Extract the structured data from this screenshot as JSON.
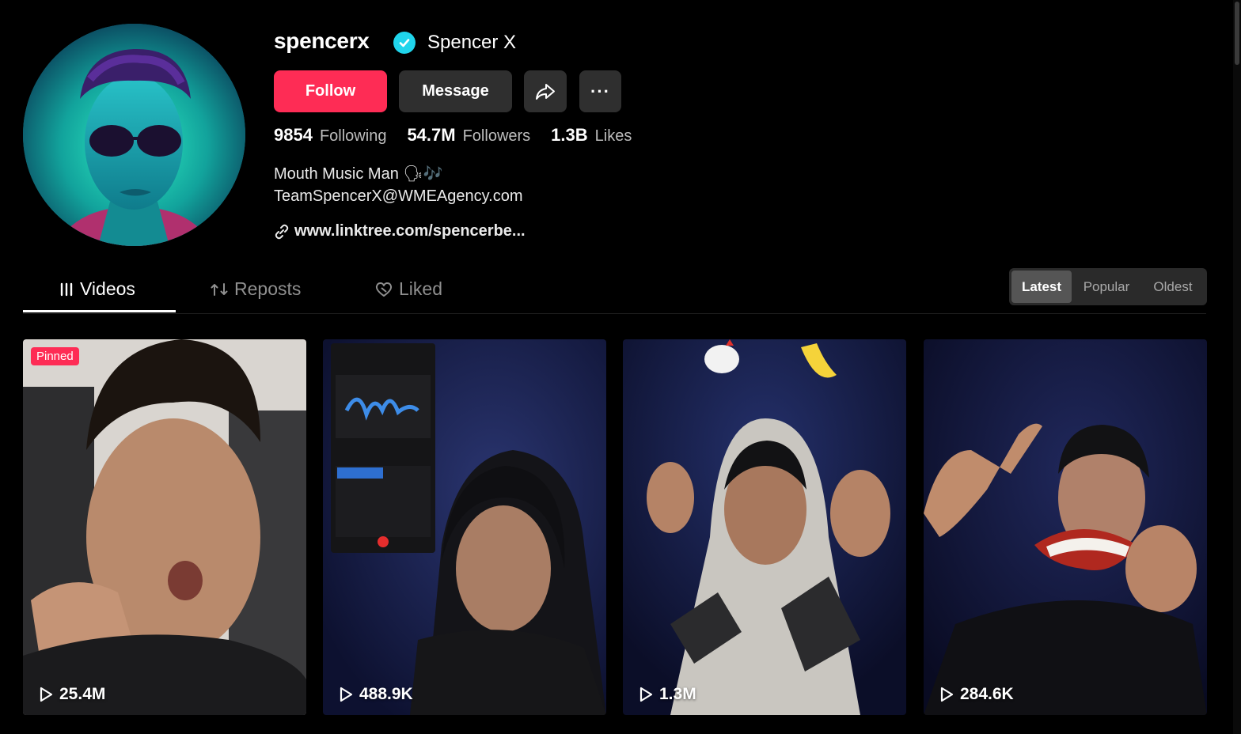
{
  "profile": {
    "username": "spencerx",
    "nickname": "Spencer X",
    "follow_label": "Follow",
    "message_label": "Message",
    "more_label": "···",
    "stats": {
      "following": "9854",
      "following_label": "Following",
      "followers": "54.7M",
      "followers_label": "Followers",
      "likes": "1.3B",
      "likes_label": "Likes"
    },
    "bio_line1": "Mouth Music Man 🗣🎶",
    "bio_line2": "TeamSpencerX@WMEAgency.com",
    "link": "www.linktree.com/spencerbe..."
  },
  "tabs": [
    {
      "label": "Videos",
      "icon": "grid-icon"
    },
    {
      "label": "Reposts",
      "icon": "repost-icon"
    },
    {
      "label": "Liked",
      "icon": "heart-icon"
    }
  ],
  "sort": [
    "Latest",
    "Popular",
    "Oldest"
  ],
  "videos": [
    {
      "views": "25.4M",
      "badge": "Pinned"
    },
    {
      "views": "488.9K"
    },
    {
      "views": "1.3M"
    },
    {
      "views": "284.6K"
    }
  ],
  "colors": {
    "accent": "#fe2c55",
    "verified": "#20d5ec",
    "background": "#000000"
  }
}
